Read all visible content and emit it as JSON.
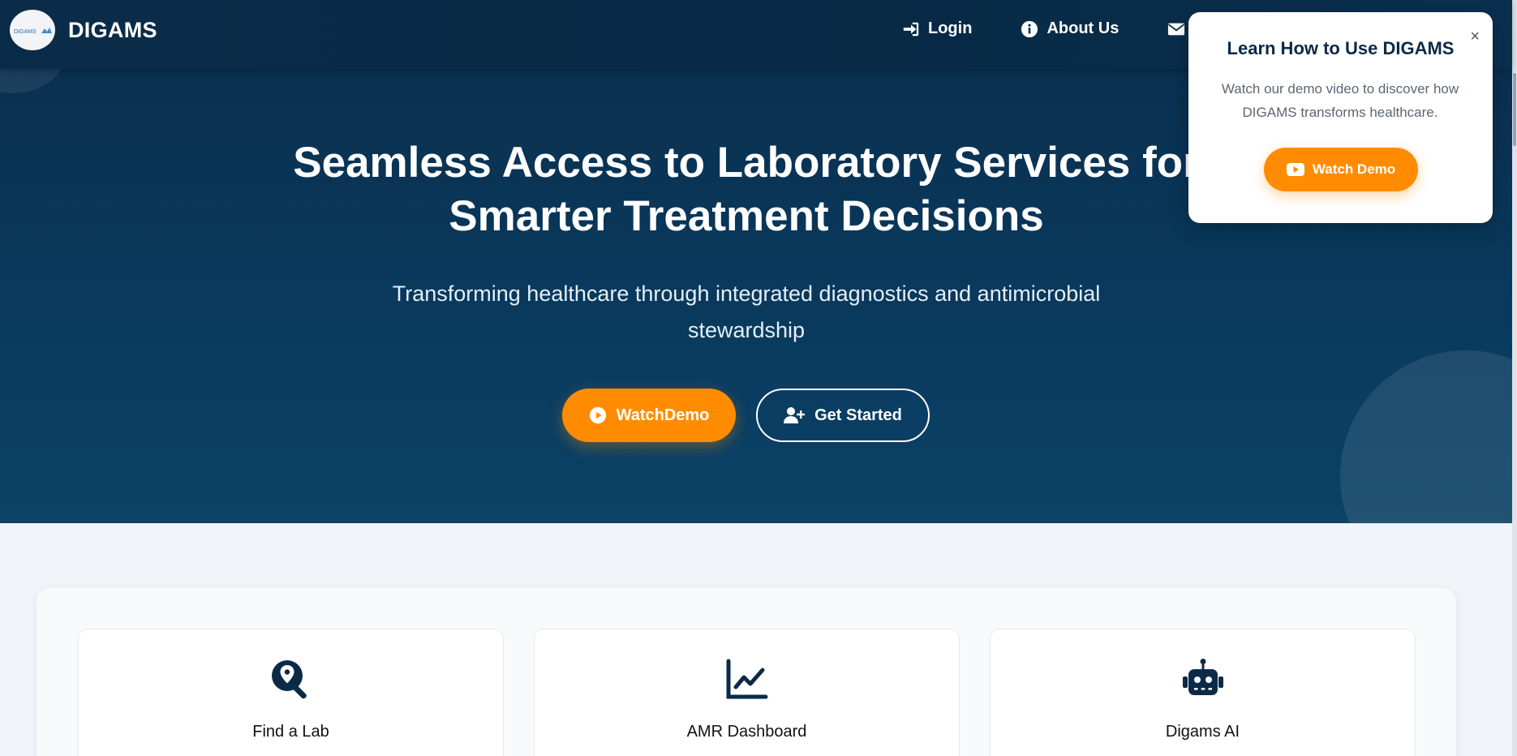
{
  "nav": {
    "brand": "DIGAMS",
    "logo_text": "DIGAMS",
    "links": [
      {
        "label": "Login",
        "icon": "login-icon"
      },
      {
        "label": "About Us",
        "icon": "info-icon"
      },
      {
        "label": "",
        "icon": "envelope-icon"
      }
    ]
  },
  "hero": {
    "title": "Seamless Access to Laboratory Services for Smarter Treatment Decisions",
    "subtitle": "Transforming healthcare through integrated diagnostics and antimicrobial stewardship",
    "watch_label": "WatchDemo",
    "start_label": "Get Started"
  },
  "popup": {
    "title": "Learn How to Use DIGAMS",
    "text": "Watch our demo video to discover how DIGAMS transforms healthcare.",
    "button_label": "Watch Demo",
    "close": "×"
  },
  "features": [
    {
      "label": "Find a Lab",
      "icon": "search-location-icon"
    },
    {
      "label": "AMR Dashboard",
      "icon": "line-chart-icon"
    },
    {
      "label": "Digams AI",
      "icon": "robot-icon"
    }
  ],
  "colors": {
    "navy": "#0a2c48",
    "accent": "#ff8c00",
    "icon": "#0b2a47"
  }
}
